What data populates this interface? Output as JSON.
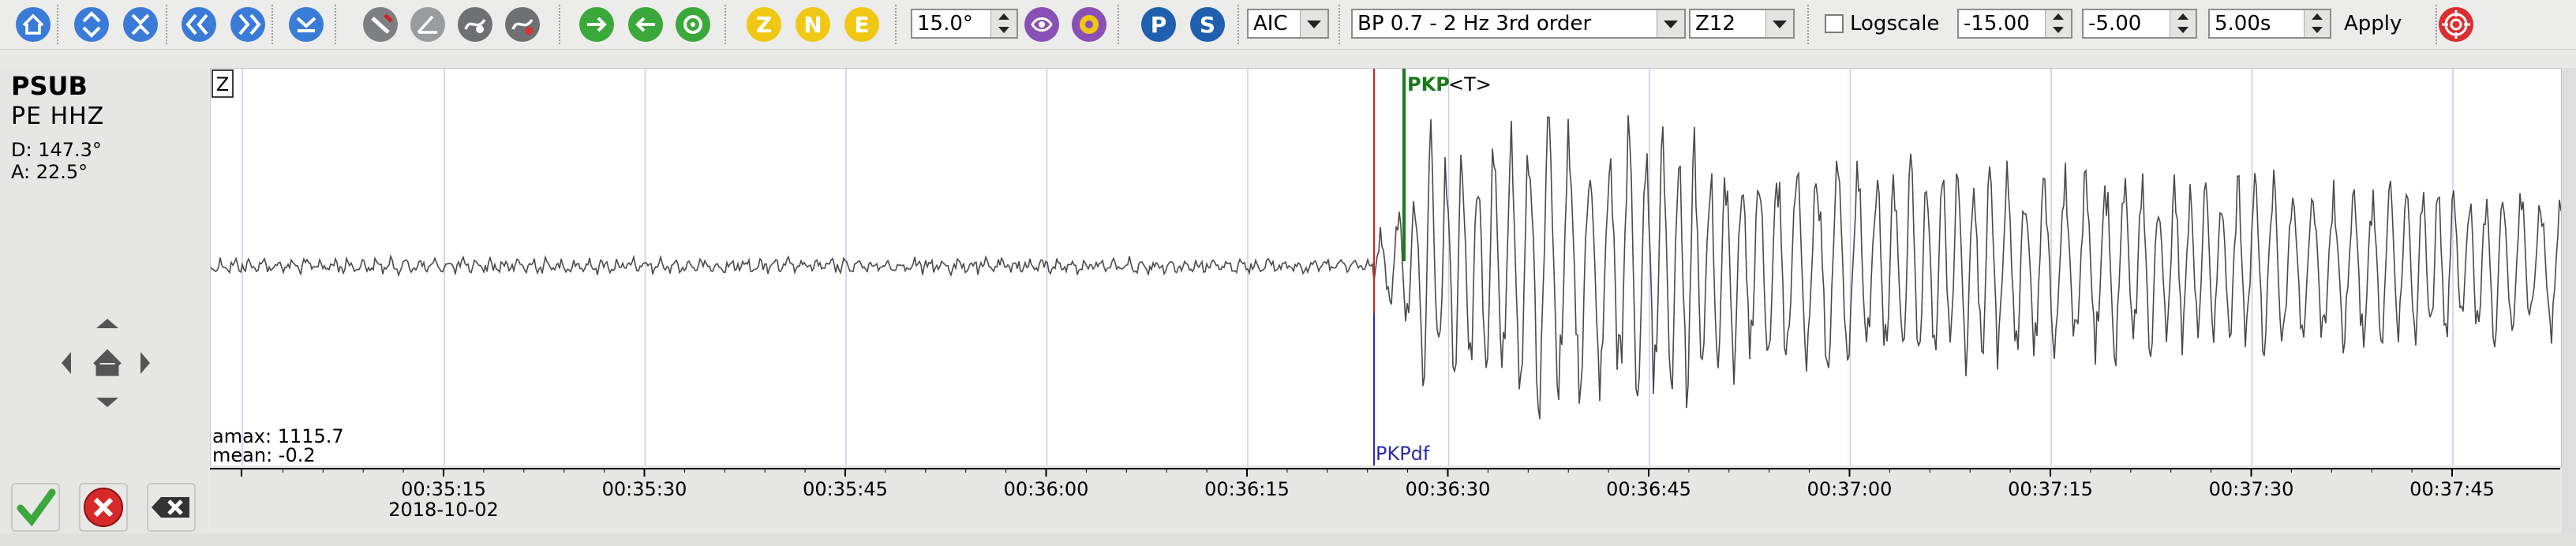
{
  "toolbar": {
    "icons": [
      {
        "name": "home-icon",
        "color": "#3b7bd8"
      },
      {
        "name": "zoom-in-vertical-icon",
        "color": "#3b7bd8"
      },
      {
        "name": "zoom-out-vertical-icon",
        "color": "#3b7bd8"
      },
      {
        "name": "previous-icon",
        "color": "#3b7bd8"
      },
      {
        "name": "next-icon",
        "color": "#3b7bd8"
      },
      {
        "name": "align-icon",
        "color": "#3b7bd8"
      },
      {
        "name": "filter-toggle-icon",
        "color": "#888888"
      },
      {
        "name": "measure-icon",
        "color": "#888888"
      },
      {
        "name": "spectrogram-icon",
        "color": "#888888"
      },
      {
        "name": "record-icon",
        "color": "#888888"
      },
      {
        "name": "forward-green-icon",
        "color": "#3aa83a"
      },
      {
        "name": "backward-green-icon",
        "color": "#3aa83a"
      },
      {
        "name": "refresh-green-icon",
        "color": "#3aa83a"
      },
      {
        "name": "component-z-button",
        "label": "Z",
        "color": "#f0c814"
      },
      {
        "name": "component-n-button",
        "label": "N",
        "color": "#f0c814"
      },
      {
        "name": "component-e-button",
        "label": "E",
        "color": "#f0c814"
      },
      {
        "name": "pick-eye-icon",
        "color": "#8a50b5"
      },
      {
        "name": "pick-face-icon",
        "color": "#8a50b5"
      },
      {
        "name": "pick-p-button",
        "label": "P",
        "color": "#1f5fae"
      },
      {
        "name": "pick-s-button",
        "label": "S",
        "color": "#1f5fae"
      },
      {
        "name": "target-icon",
        "color": "#d93030"
      }
    ],
    "angle_value": "15.0°",
    "picker_select": "AIC",
    "filter_select": "BP 0.7 - 2 Hz  3rd order",
    "component_select": "Z12",
    "logscale_label": "Logscale",
    "window_start": "-15.00",
    "window_end": "-5.00",
    "window_length": "5.00s",
    "apply_label": "Apply"
  },
  "station": {
    "code": "PSUB",
    "network_channel": "PE   HHZ",
    "distance": "D:  147.3°",
    "azimuth": "A:   22.5°"
  },
  "trace": {
    "component_tag": "Z",
    "amax": "amax: 1115.7",
    "mean": "mean: -0.2",
    "pick_label": "PKP",
    "pick_suffix": "<T>",
    "theoretical_label": "PKPdf",
    "colors": {
      "trace": "#4a4a4a",
      "gridline": "#c9c9f5",
      "pick": "#1a7a1a",
      "theory": "#2a2ab0",
      "marker": "#d62020"
    }
  },
  "axis": {
    "ticks": [
      "00:35:15",
      "00:35:30",
      "00:35:45",
      "00:36:00",
      "00:36:15",
      "00:36:30",
      "00:36:45",
      "00:37:00",
      "00:37:15",
      "00:37:30",
      "00:37:45"
    ],
    "date": "2018-10-02"
  },
  "actions": {
    "accept": "accept-check-icon",
    "reject": "reject-x-icon",
    "delete": "delete-icon"
  }
}
